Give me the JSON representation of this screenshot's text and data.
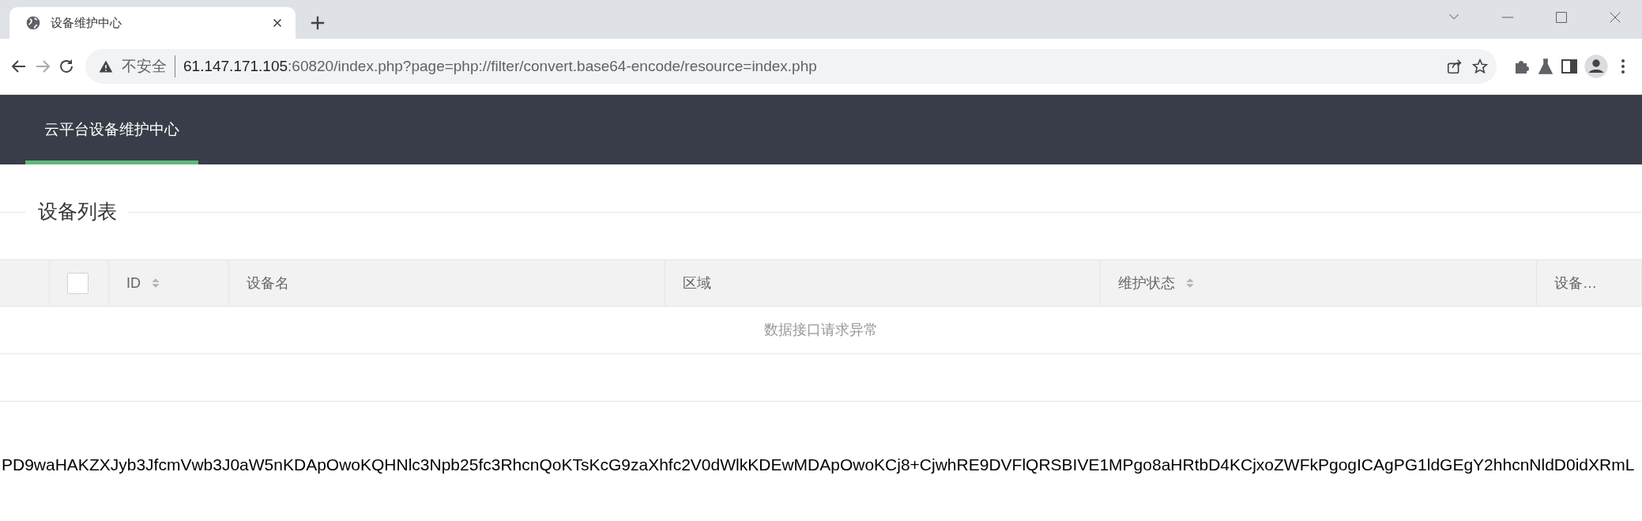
{
  "browser": {
    "tab": {
      "title": "设备维护中心",
      "selected": true
    },
    "address": {
      "security_label": "不安全",
      "host": "61.147.171.105",
      "path": ":60820/index.php?page=php://filter/convert.base64-encode/resource=index.php"
    }
  },
  "navbar": {
    "items": [
      {
        "label": "云平台设备维护中心",
        "selected": true
      }
    ]
  },
  "section": {
    "legend": "设备列表"
  },
  "table": {
    "columns": [
      {
        "kind": "blank"
      },
      {
        "kind": "checkbox",
        "checked": false
      },
      {
        "kind": "text",
        "label": "ID",
        "sortable": true
      },
      {
        "kind": "text",
        "label": "设备名",
        "sortable": false
      },
      {
        "kind": "text",
        "label": "区域",
        "sortable": false
      },
      {
        "kind": "text",
        "label": "维护状态",
        "sortable": true
      },
      {
        "kind": "text",
        "label": "设备…",
        "sortable": false
      }
    ],
    "empty_message": "数据接口请求异常"
  },
  "output_text": "PD9waHAKZXJyb3JfcmVwb3J0aW5nKDApOwoKQHNlc3Npb25fc3RhcnQoKTsKcG9zaXhfc2V0dWlkKDEwMDApOwoKCj8+CjwhRE9DVFlQRSBIVE1MPgo8aHRtbD4KCjxoZWFkPgogICAgPG1ldGEgY2hhcnNldD0idXRmL"
}
